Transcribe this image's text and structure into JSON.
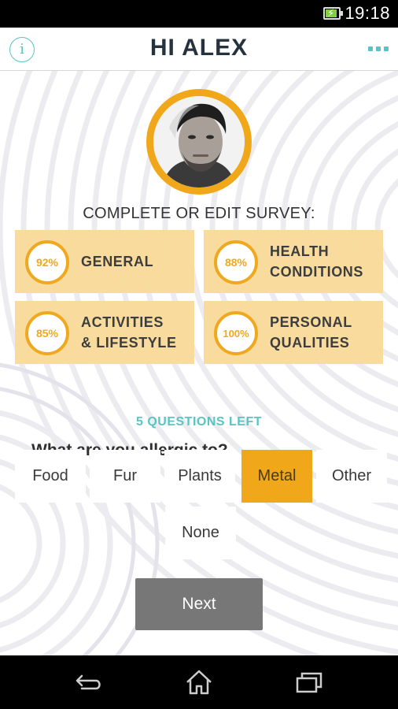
{
  "status_bar": {
    "time": "19:18"
  },
  "header": {
    "title": "HI ALEX",
    "info_glyph": "i"
  },
  "survey": {
    "heading": "COMPLETE OR EDIT SURVEY:",
    "sections": [
      {
        "percent": "92%",
        "label_line1": "GENERAL",
        "label_line2": ""
      },
      {
        "percent": "88%",
        "label_line1": "HEALTH",
        "label_line2": "CONDITIONS"
      },
      {
        "percent": "85%",
        "label_line1": "ACTIVITIES",
        "label_line2": "& LIFESTYLE"
      },
      {
        "percent": "100%",
        "label_line1": "PERSONAL",
        "label_line2": "QUALITIES"
      }
    ]
  },
  "question": {
    "remaining": "5 QUESTIONS LEFT",
    "text": "What are you allergic to?",
    "options": [
      "Food",
      "Fur",
      "Plants",
      "Metal",
      "Other",
      "None"
    ],
    "selected": "Metal"
  },
  "next_button": {
    "label": "Next"
  },
  "colors": {
    "accent": "#f0a81a",
    "card_bg": "#f9dc9c",
    "teal": "#58c4c4",
    "button_gray": "#777777"
  },
  "icons": {
    "battery": "battery-charging-icon",
    "info": "info-icon",
    "menu": "more-dots-icon",
    "back": "back-icon",
    "home": "home-icon",
    "recents": "recent-apps-icon"
  }
}
